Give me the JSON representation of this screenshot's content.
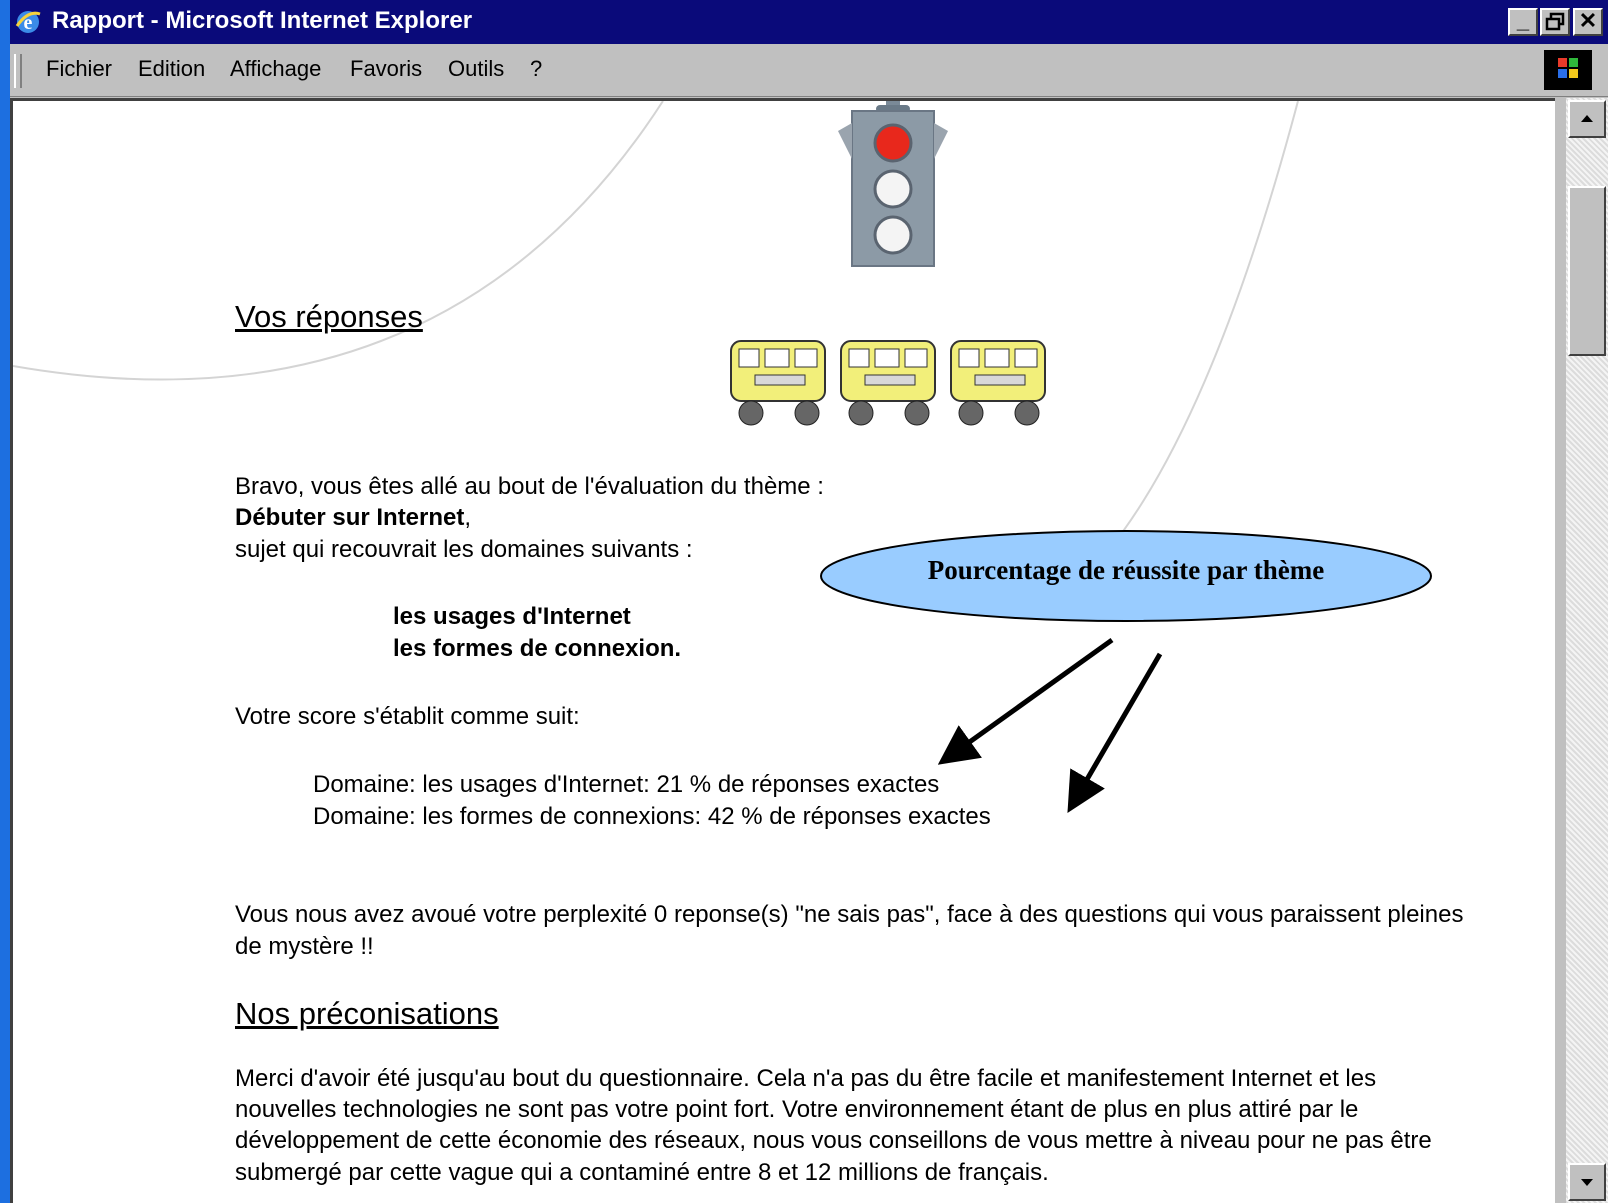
{
  "window": {
    "title": "Rapport - Microsoft Internet Explorer"
  },
  "menu": {
    "items": [
      "Fichier",
      "Edition",
      "Affichage",
      "Favoris",
      "Outils",
      "?"
    ]
  },
  "page": {
    "heading_responses": "Vos réponses",
    "intro_line1": "Bravo, vous êtes allé au bout de l'évaluation du thème :",
    "theme_name": "Débuter sur Internet",
    "theme_suffix": ",",
    "intro_line3": "sujet qui recouvrait les domaines suivants :",
    "domain1": "les usages d'Internet",
    "domain2": "les formes de connexion.",
    "score_intro": "Votre score s'établit comme suit:",
    "score_line1": "Domaine: les usages d'Internet: 21 % de réponses exactes",
    "score_line2": "Domaine: les formes de connexions: 42 % de réponses exactes",
    "perplexity_line1": "Vous nous avez avoué votre perplexité 0 reponse(s) \"ne sais pas\", face à des questions qui vous paraissent pleines",
    "perplexity_line2": "de mystère !!",
    "heading_recommendations": "Nos préconisations",
    "reco_line1": "Merci d'avoir été jusqu'au bout du questionnaire. Cela n'a pas du être facile et manifestement Internet et les",
    "reco_line2": "nouvelles technologies ne sont pas votre point fort. Votre environnement étant de plus en plus attiré par le",
    "reco_line3": "développement de cette économie des réseaux, nous vous conseillons de vous mettre à niveau pour ne pas être",
    "reco_line4": "submergé par cette vague qui a contaminé entre 8 et 12 millions de français."
  },
  "callout": {
    "text": "Pourcentage de réussite par thème"
  },
  "scores": {
    "usages_pct": 21,
    "connexions_pct": 42
  },
  "traffic_light": {
    "active": "red"
  },
  "colors": {
    "titlebar": "#0a0a7a",
    "callout_fill": "#99ccff",
    "desktop": "#1d6fe0",
    "light_red": "#e8281c"
  }
}
